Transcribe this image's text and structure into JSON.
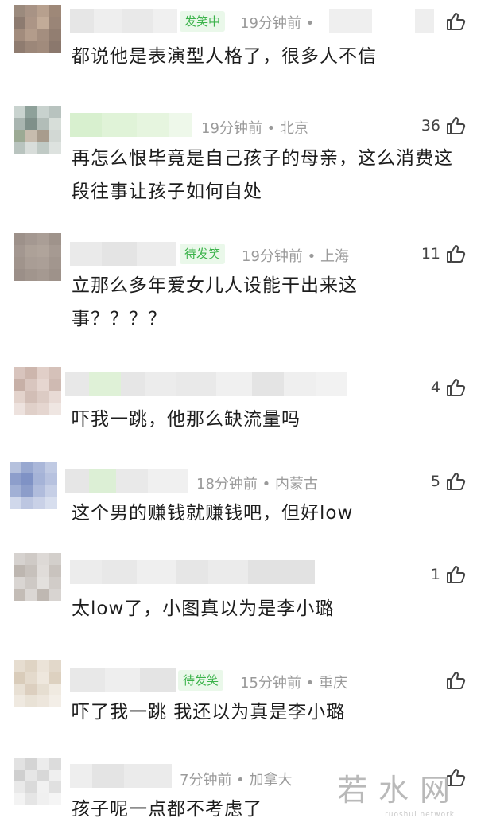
{
  "comments": [
    {
      "badge": "发笑中",
      "meta": "19分钟前 •",
      "likes": "",
      "text": "都说他是表演型人格了，很多人不信"
    },
    {
      "badge": "",
      "meta": "19分钟前 • 北京",
      "likes": "36",
      "text": "再怎么恨毕竟是自己孩子的母亲，这么消费这段往事让孩子如何自处"
    },
    {
      "badge": "待发笑",
      "meta": "19分钟前 • 上海",
      "likes": "11",
      "text": "立那么多年爱女儿人设能干出来这事？？？？"
    },
    {
      "badge": "",
      "meta": "",
      "likes": "4",
      "text": "吓我一跳，他那么缺流量吗"
    },
    {
      "badge": "",
      "meta": "18分钟前 • 内蒙古",
      "likes": "5",
      "text": "这个男的赚钱就赚钱吧，但好low"
    },
    {
      "badge": "",
      "meta": "",
      "likes": "1",
      "text": "太low了，小图真以为是李小璐"
    },
    {
      "badge": "待发笑",
      "meta": "15分钟前 • 重庆",
      "likes": "",
      "text": "吓了我一跳  我还以为真是李小璐"
    },
    {
      "badge": "",
      "meta": "7分钟前 • 加拿大",
      "likes": "",
      "text": "孩子呢一点都不考虑了"
    }
  ],
  "watermark": "若水网",
  "watermark_sub": "ruoshui network",
  "colors": {
    "badge_bg": "#eaf8ea",
    "badge_text": "#3bb34a",
    "meta": "#9a9a9a"
  },
  "icons": {
    "like": "thumbs-up-icon",
    "avatar": "avatar"
  }
}
